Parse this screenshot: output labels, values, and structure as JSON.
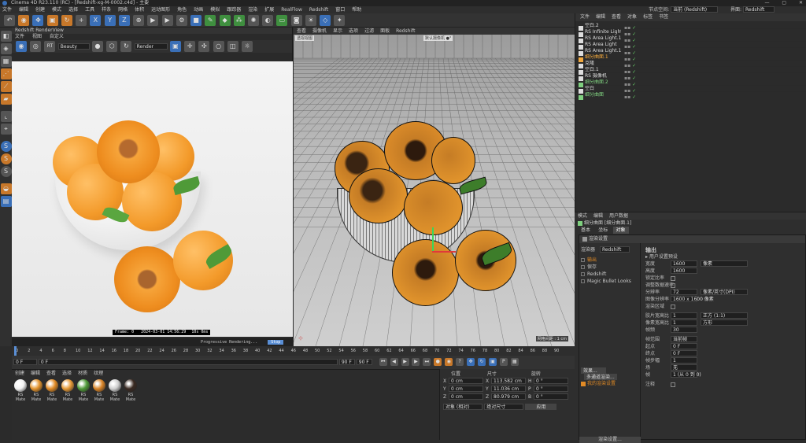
{
  "titlebar": {
    "title": "Cinema 4D R23.110 (RC) - [Redshift-xg-M-0002.c4d] - 主要",
    "min": "—",
    "max": "▢",
    "close": "✕"
  },
  "menubar": {
    "items": [
      "文件",
      "编辑",
      "创建",
      "模式",
      "选择",
      "工具",
      "样条",
      "网格",
      "体积",
      "运动图形",
      "角色",
      "动画",
      "模拟",
      "跟踪器",
      "渲染",
      "扩展",
      "RealFlow",
      "Redshift",
      "窗口",
      "帮助"
    ],
    "right_label": "节点空间:",
    "right_value": "当前 (Redshift)",
    "layout_label": "界面:",
    "layout_value": "Redshift"
  },
  "toolbar": {
    "xyz": [
      "X",
      "Y",
      "Z"
    ]
  },
  "render_view": {
    "title": "Redshift RenderView",
    "menus": [
      "文件",
      "视图",
      "自定义"
    ],
    "mode": "Beauty",
    "filter": "Render",
    "stamp_frame": "Frame: 0",
    "stamp_time": "2024-03-01 14:56:29",
    "stamp_dev": "10s 0ms",
    "status": "Progressive Rendering...",
    "status_btn": "Stop"
  },
  "viewport": {
    "menus": [
      "查看",
      "摄像机",
      "显示",
      "选项",
      "过滤",
      "面板",
      "Redshift"
    ],
    "label": "透视视图",
    "camera": "默认摄像机 ●°",
    "grid": "网格间距 : 1 cm"
  },
  "timeline": {
    "ticks": [
      "0",
      "2",
      "4",
      "6",
      "8",
      "10",
      "12",
      "14",
      "16",
      "18",
      "20",
      "22",
      "24",
      "26",
      "28",
      "30",
      "32",
      "34",
      "36",
      "38",
      "40",
      "42",
      "44",
      "46",
      "48",
      "50",
      "52",
      "54",
      "56",
      "58",
      "60",
      "62",
      "64",
      "66",
      "68",
      "70",
      "72",
      "74",
      "76",
      "78",
      "80",
      "82",
      "84",
      "86",
      "88",
      "90"
    ],
    "start": "0 F",
    "start2": "0 F",
    "end": "90 F",
    "end2": "90 F",
    "cur": "0 F"
  },
  "materials": {
    "menus": [
      "创建",
      "编辑",
      "查看",
      "选择",
      "材质",
      "纹理"
    ],
    "items": [
      {
        "label": "RS Mate",
        "color": "#f2f2f2"
      },
      {
        "label": "RS Mate",
        "color": "#e4932c"
      },
      {
        "label": "RS Mate",
        "color": "#e08a25"
      },
      {
        "label": "RS Mate",
        "color": "#e69a36"
      },
      {
        "label": "RS Mate",
        "color": "#4f9a38"
      },
      {
        "label": "RS Mate",
        "color": "#d98326"
      },
      {
        "label": "RS Mate",
        "color": "#cfcfcf"
      },
      {
        "label": "RS Mate",
        "color": "#3a2a22"
      }
    ]
  },
  "coords": {
    "headers": [
      "位置",
      "尺寸",
      "旋转"
    ],
    "rows": [
      {
        "a": "X",
        "av": "0 cm",
        "b": "X",
        "bv": "113.582 cm",
        "c": "H",
        "cv": "0 °"
      },
      {
        "a": "Y",
        "av": "0 cm",
        "b": "Y",
        "bv": "11.036 cm",
        "c": "P",
        "cv": "0 °"
      },
      {
        "a": "Z",
        "av": "0 cm",
        "b": "Z",
        "bv": "80.979 cm",
        "c": "B",
        "cv": "0 °"
      }
    ],
    "mode1": "对象 (相对)",
    "mode2": "绝对尺寸",
    "apply": "应用"
  },
  "objects": {
    "menus": [
      "文件",
      "编辑",
      "查看",
      "对象",
      "标签",
      "书签"
    ],
    "rows": [
      {
        "name": "空白.2",
        "color": "#ddd"
      },
      {
        "name": "RS Infinite Light",
        "color": "#ddd"
      },
      {
        "name": "RS Area Light.1",
        "color": "#ddd"
      },
      {
        "name": "RS Area Light",
        "color": "#ddd"
      },
      {
        "name": "RS Area Light.1",
        "color": "#ddd"
      },
      {
        "name": "细分曲面.1",
        "color": "#f2a83c"
      },
      {
        "name": "克隆",
        "color": "#ddd"
      },
      {
        "name": "空白.1",
        "color": "#ddd"
      },
      {
        "name": "RS 摄像机",
        "color": "#ddd"
      },
      {
        "name": "细分曲面.2",
        "color": "#7fd07f"
      },
      {
        "name": "空白",
        "color": "#ddd"
      },
      {
        "name": "细分曲面",
        "color": "#7fd07f"
      }
    ]
  },
  "attributes": {
    "menus": [
      "模式",
      "编辑",
      "用户数据"
    ],
    "object": "细分曲面 [细分曲面.1]",
    "tabs": [
      "基本",
      "坐标",
      "对象"
    ]
  },
  "render_settings": {
    "title": "渲染设置",
    "renderer_label": "渲染器",
    "renderer": "Redshift",
    "list": [
      "输出",
      "保存",
      "Redshift",
      "Magic Bullet Looks"
    ],
    "section": "输出",
    "preset": "用户设置预设",
    "rows": [
      {
        "label": "宽度",
        "value": "1600",
        "unit": "像素"
      },
      {
        "label": "高度",
        "value": "1600",
        "unit": ""
      },
      {
        "label": "锁定比率",
        "value": "",
        "unit": ""
      },
      {
        "label": "调整数据速率",
        "value": "",
        "unit": ""
      },
      {
        "label": "分辨率",
        "value": "72",
        "unit": "像素/英寸(DPI)"
      },
      {
        "label": "图像分辨率",
        "value": "1600 x 1600 像素",
        "unit": ""
      },
      {
        "label": "渲染区域",
        "value": "",
        "unit": ""
      },
      {
        "label": "胶片宽高比",
        "value": "1",
        "unit": "正方 (1:1)"
      },
      {
        "label": "像素宽高比",
        "value": "1",
        "unit": "方形"
      },
      {
        "label": "帧频",
        "value": "30",
        "unit": ""
      },
      {
        "label": "帧范围",
        "value": "当前帧",
        "unit": ""
      },
      {
        "label": "起点",
        "value": "0 F",
        "unit": ""
      },
      {
        "label": "终点",
        "value": "0 F",
        "unit": ""
      },
      {
        "label": "帧步幅",
        "value": "1",
        "unit": ""
      },
      {
        "label": "场",
        "value": "无",
        "unit": ""
      },
      {
        "label": "帧",
        "value": "1 (从 0 到 0)",
        "unit": ""
      },
      {
        "label": "注释",
        "value": "",
        "unit": ""
      }
    ],
    "effects_btn": "效果...",
    "multi_btn": "多通道渲染...",
    "my_settings": "我的渲染设置",
    "bottom_btn": "渲染设置..."
  }
}
